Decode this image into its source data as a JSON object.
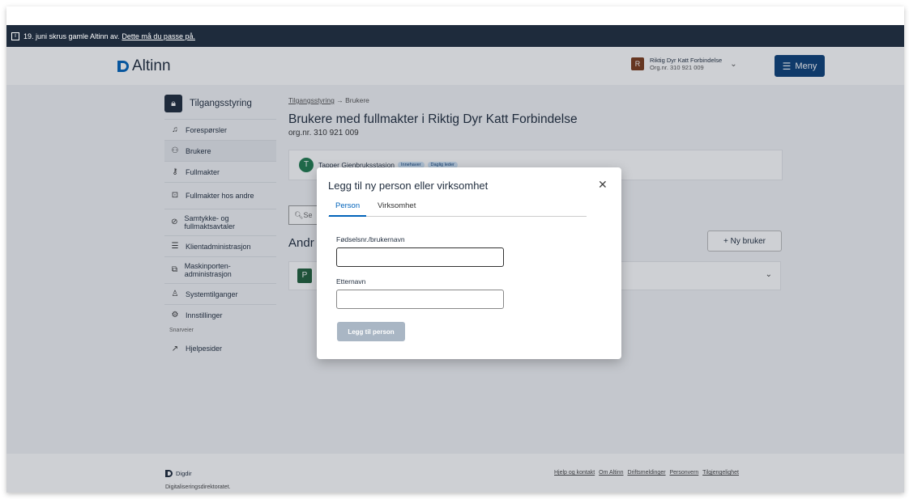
{
  "banner": {
    "text": "19. juni skrus gamle Altinn av.",
    "link": "Dette må du passe på."
  },
  "header": {
    "logo_text": "Altinn",
    "account_initial": "R",
    "account_name": "Riktig Dyr Katt Forbindelse",
    "account_org": "Org.nr. 310 921 009",
    "menu_label": "Meny"
  },
  "sidebar": {
    "title": "Tilgangsstyring",
    "items": [
      {
        "label": "Forespørsler",
        "icon": "bell-icon"
      },
      {
        "label": "Brukere",
        "icon": "users-icon"
      },
      {
        "label": "Fullmakter",
        "icon": "key-icon"
      },
      {
        "label": "Fullmakter hos andre",
        "icon": "lock-icon"
      },
      {
        "label": "Samtykke- og fullmaktsavtaler",
        "icon": "handshake-icon"
      },
      {
        "label": "Klientadministrasjon",
        "icon": "database-icon"
      },
      {
        "label": "Maskinporten- administrasjon",
        "icon": "connect-icon"
      },
      {
        "label": "Systemtilganger",
        "icon": "person-gear-icon"
      },
      {
        "label": "Innstillinger",
        "icon": "gear-icon"
      }
    ],
    "shortcuts_label": "Snarveier",
    "help_label": "Hjelpesider"
  },
  "main": {
    "breadcrumb_link": "Tilgangsstyring",
    "breadcrumb_current": "Brukere",
    "title": "Brukere med fullmakter i Riktig Dyr Katt Forbindelse",
    "orgnr": "org.nr. 310 921 009",
    "user_initial": "T",
    "user_name": "Tapper Gjenbruksstasjon",
    "badge_owner": "Innehaver",
    "badge_leader": "Daglig leder",
    "search_partial": "Se",
    "section_partial": "Andr",
    "new_user_label": "Ny bruker",
    "list_initial": "P"
  },
  "modal": {
    "title": "Legg til ny person eller virksomhet",
    "tab_person": "Person",
    "tab_business": "Virksomhet",
    "field1_label": "Fødselsnr./brukernavn",
    "field1_value": "",
    "field2_label": "Etternavn",
    "field2_value": "",
    "submit_label": "Legg til person"
  },
  "footer": {
    "org": "Digdir",
    "org_full": "Digitaliseringsdirektoratet.",
    "links": [
      "Hjelp og kontakt",
      "Om Altinn",
      "Driftsmeldinger",
      "Personvern",
      "Tilgjengelighet"
    ]
  }
}
